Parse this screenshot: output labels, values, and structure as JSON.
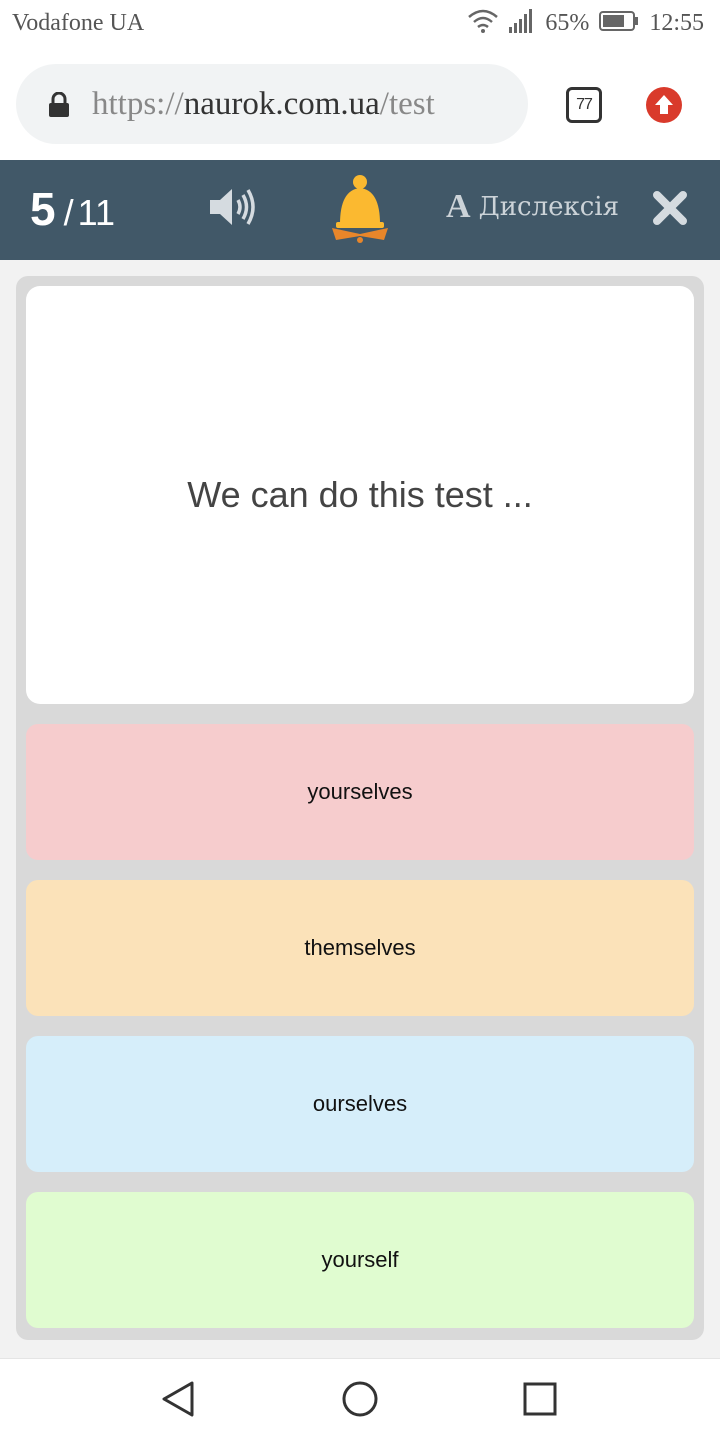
{
  "status_bar": {
    "carrier": "Vodafone UA",
    "battery": "65%",
    "time": "12:55"
  },
  "browser": {
    "url_scheme": "https://",
    "url_host": "naurok.com.ua",
    "url_path": "/test",
    "tab_count": "77",
    "icons": {
      "lock": "lock-icon",
      "update": "arrow-up-icon"
    }
  },
  "quiz_header": {
    "current": "5",
    "separator": "/",
    "total": "11",
    "dyslexia_label": "Дислексія",
    "dyslexia_letter": "A",
    "icons": {
      "sound": "speaker-icon",
      "bell": "bell-icon",
      "close": "close-icon"
    }
  },
  "question": {
    "text": "We can do this test ..."
  },
  "answers": [
    {
      "label": "yourselves",
      "color": "#f6cccd"
    },
    {
      "label": "themselves",
      "color": "#fbe2b9"
    },
    {
      "label": "ourselves",
      "color": "#d6eefa"
    },
    {
      "label": "yourself",
      "color": "#e0fcd0"
    }
  ],
  "colors": {
    "header": "#415868",
    "bell": "#fbb930",
    "bell_book": "#e8862a",
    "update": "#d93a2b"
  },
  "nav_bar": {
    "icons": [
      "back-icon",
      "home-icon",
      "recent-apps-icon"
    ]
  }
}
